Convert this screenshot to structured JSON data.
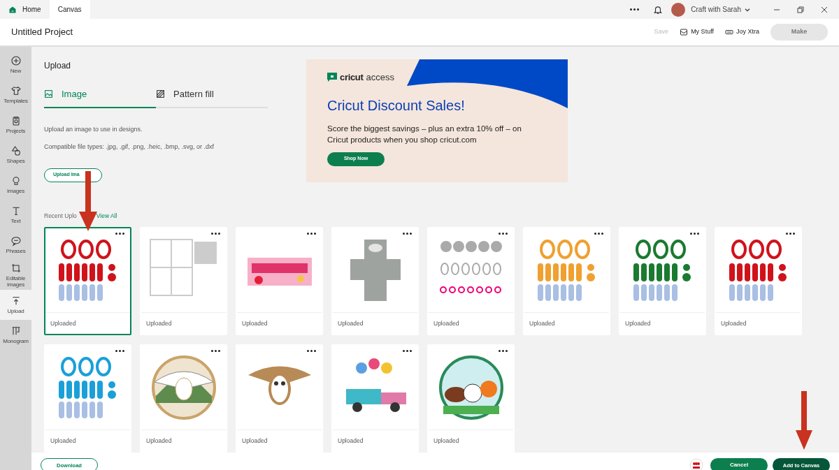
{
  "tabs": [
    {
      "label": "Home",
      "selected": false,
      "kind": "home"
    },
    {
      "label": "Canvas",
      "selected": true,
      "kind": "plain"
    }
  ],
  "account": {
    "name": "Craft with Sarah"
  },
  "header": {
    "title": "Untitled Project",
    "save": {
      "label": "Save",
      "disabled": true
    },
    "my_stuff": "My Stuff",
    "joy_xtra": "Joy Xtra",
    "make": {
      "label": "Make",
      "disabled": true
    }
  },
  "sidebar": {
    "items": [
      {
        "label": "New",
        "kind": "new",
        "selected": false
      },
      {
        "label": "Templates",
        "kind": "templates",
        "selected": false
      },
      {
        "label": "Projects",
        "kind": "projects",
        "selected": false
      },
      {
        "label": "Shapes",
        "kind": "shapes",
        "selected": false
      },
      {
        "label": "Images",
        "kind": "images",
        "selected": false
      },
      {
        "label": "Text",
        "kind": "text",
        "selected": false
      },
      {
        "label": "Phrases",
        "kind": "phrases",
        "selected": false
      },
      {
        "label": "Editable Images",
        "kind": "editable",
        "selected": false
      },
      {
        "label": "Upload",
        "kind": "upload",
        "selected": true
      },
      {
        "label": "Monogram",
        "kind": "monogram",
        "selected": false
      }
    ]
  },
  "upload": {
    "title": "Upload",
    "tabs": [
      {
        "label": "Image",
        "kind": "image",
        "selected": true
      },
      {
        "label": "Pattern fill",
        "kind": "pattern",
        "selected": false
      }
    ],
    "description": "Upload an image to use in designs.",
    "file_types": "Compatible file types: .jpg, .gif, .png, .heic, .bmp, .svg, or .dxf",
    "upload_button": "Upload Ima",
    "recent_label": "Recent Uplo",
    "view_all": "View All"
  },
  "banner": {
    "brand": "cricut",
    "brand_suffix": "access",
    "title": "Cricut Discount Sales!",
    "body": "Score the biggest savings – plus an extra 10% off – on Cricut products when you shop cricut.com",
    "button": "Shop Now"
  },
  "uploads": [
    {
      "label": "Uploaded",
      "selected": true,
      "kind": "ornaments",
      "color": "#d0121b"
    },
    {
      "label": "Uploaded",
      "selected": false,
      "kind": "sheet",
      "color": "#cccccc"
    },
    {
      "label": "Uploaded",
      "selected": false,
      "kind": "banner",
      "color": "#e0336a"
    },
    {
      "label": "Uploaded",
      "selected": false,
      "kind": "box",
      "color": "#9ea3a0"
    },
    {
      "label": "Uploaded",
      "selected": false,
      "kind": "outline",
      "color": "#aaaaaa"
    },
    {
      "label": "Uploaded",
      "selected": false,
      "kind": "ornaments",
      "color": "#f0a030"
    },
    {
      "label": "Uploaded",
      "selected": false,
      "kind": "ornaments",
      "color": "#1a7a30"
    },
    {
      "label": "Uploaded",
      "selected": false,
      "kind": "ornaments",
      "color": "#d0121b"
    },
    {
      "label": "Uploaded",
      "selected": false,
      "kind": "ornaments",
      "color": "#1aa0d8"
    },
    {
      "label": "Uploaded",
      "selected": false,
      "kind": "owl-round",
      "color": "#c9a46a"
    },
    {
      "label": "Uploaded",
      "selected": false,
      "kind": "owl",
      "color": "#b88a55"
    },
    {
      "label": "Uploaded",
      "selected": false,
      "kind": "truck",
      "color": "#3fb8c8"
    },
    {
      "label": "Uploaded",
      "selected": false,
      "kind": "sports",
      "color": "#2a8a5a"
    }
  ],
  "footer": {
    "download": "Download",
    "cancel": "Cancel",
    "add": "Add to Canvas"
  }
}
